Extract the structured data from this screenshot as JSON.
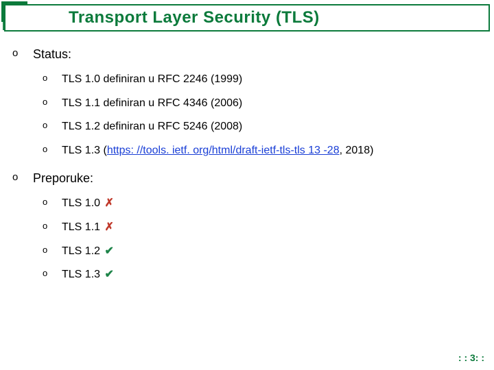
{
  "title": "Transport Layer Security (TLS)",
  "bullet_glyph": "o",
  "sections": [
    {
      "heading": "Status:",
      "items": [
        {
          "text": "TLS 1.0 definiran u RFC 2246 (1999)"
        },
        {
          "text": "TLS 1.1 definiran u RFC 4346 (2006)"
        },
        {
          "text": "TLS 1.2 definiran u RFC 5246 (2008)"
        },
        {
          "prefix": "TLS 1.3 (",
          "link_text": "https: //tools. ietf. org/html/draft-ietf-tls-tls 13 -28",
          "suffix": ", 2018)"
        }
      ]
    },
    {
      "heading": "Preporuke:",
      "items": [
        {
          "text": "TLS 1.0",
          "status": "x"
        },
        {
          "text": "TLS 1.1",
          "status": "x"
        },
        {
          "text": "TLS 1.2",
          "status": "check"
        },
        {
          "text": "TLS 1.3",
          "status": "check"
        }
      ]
    }
  ],
  "status_glyphs": {
    "x": "✗",
    "check": "✔"
  },
  "footer": ": : 3: :"
}
